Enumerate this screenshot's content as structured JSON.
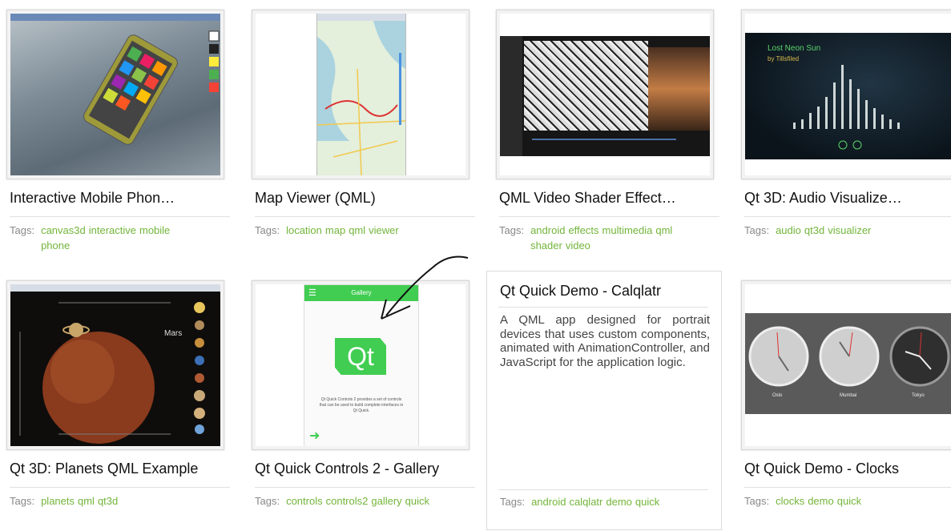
{
  "cards": [
    {
      "title": "Interactive Mobile Phon…",
      "tags_label": "Tags:",
      "tags": [
        "canvas3d",
        "interactive",
        "mobile",
        "phone"
      ]
    },
    {
      "title": "Map Viewer (QML)",
      "tags_label": "Tags:",
      "tags": [
        "location",
        "map",
        "qml",
        "viewer"
      ]
    },
    {
      "title": "QML Video Shader Effect…",
      "tags_label": "Tags:",
      "tags": [
        "android",
        "effects",
        "multimedia",
        "qml",
        "shader",
        "video"
      ]
    },
    {
      "title": "Qt 3D: Audio Visualize…",
      "tags_label": "Tags:",
      "tags": [
        "audio",
        "qt3d",
        "visualizer"
      ]
    },
    {
      "title": "Qt 3D: Planets QML Example",
      "tags_label": "Tags:",
      "tags": [
        "planets",
        "qml",
        "qt3d"
      ]
    },
    {
      "title": "Qt Quick Controls 2 - Gallery",
      "tags_label": "Tags:",
      "tags": [
        "controls",
        "controls2",
        "gallery",
        "quick"
      ]
    },
    {
      "title": "Qt Quick Demo - Calqlatr",
      "description": "A QML app designed for portrait devices that uses custom components, animated with AnimationController, and JavaScript for the application logic.",
      "tags_label": "Tags:",
      "tags": [
        "android",
        "calqlatr",
        "demo",
        "quick"
      ]
    },
    {
      "title": "Qt Quick Demo - Clocks",
      "tags_label": "Tags:",
      "tags": [
        "clocks",
        "demo",
        "quick"
      ]
    }
  ],
  "thumb_text": {
    "audio_title": "Lost Neon Sun",
    "audio_artist": "by Tillsfiled",
    "planet_name": "Mars",
    "gallery_header": "Gallery",
    "qt_logo": "Qt",
    "gallery_caption": "Qt Quick Controls 2 provides a set of controls that can be used to build complete interfaces in Qt Quick.",
    "clock_cities": [
      "Oslo",
      "Mumbai",
      "Tokyo"
    ]
  },
  "colors": {
    "tag_green": "#73b53a",
    "qt_green": "#41cd52",
    "title_text": "#111111"
  }
}
